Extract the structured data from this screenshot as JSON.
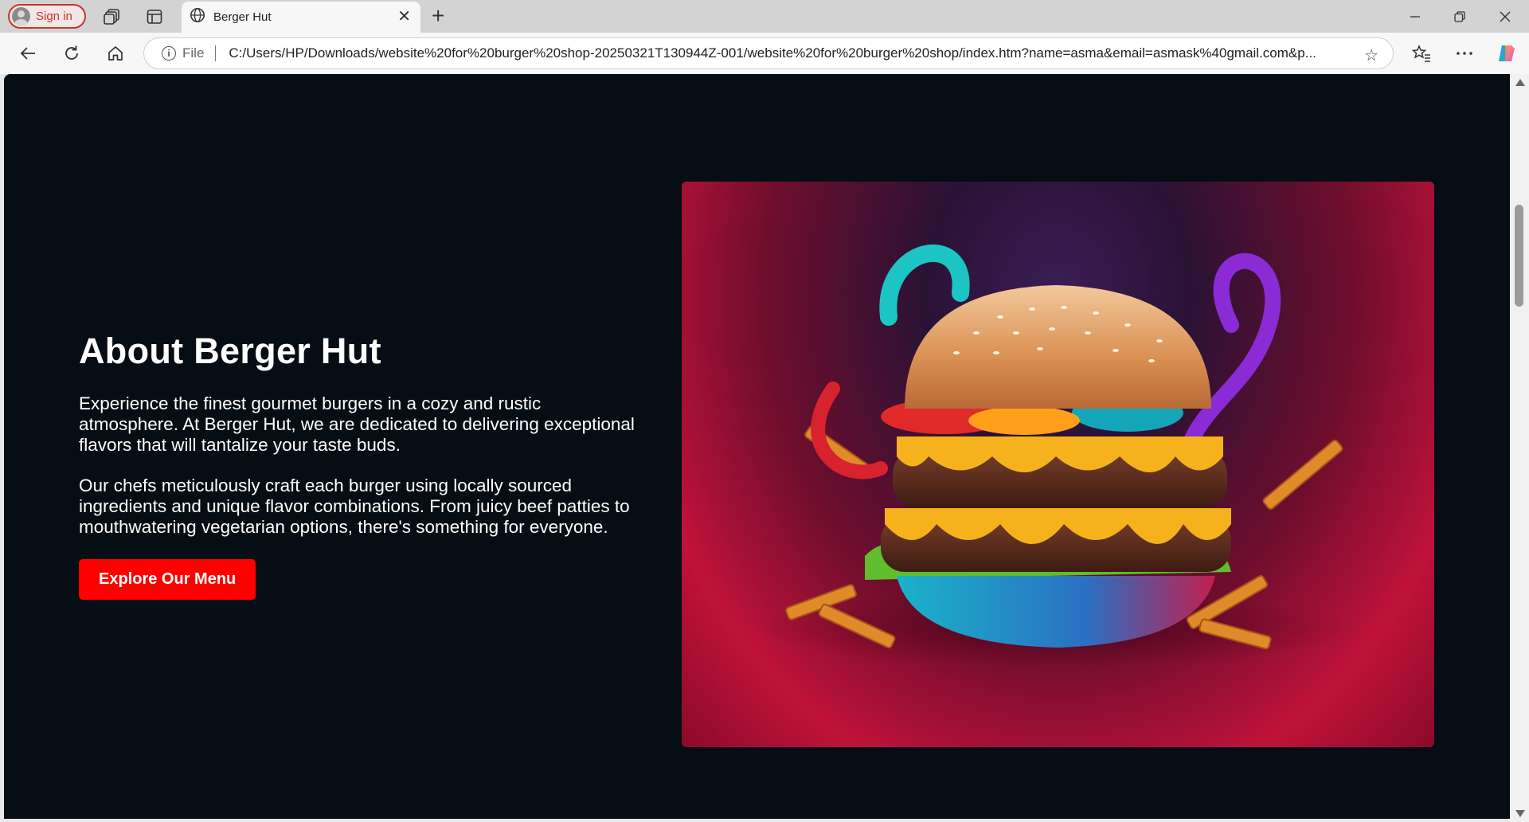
{
  "browser": {
    "signin_label": "Sign in",
    "tab_title": "Berger Hut",
    "omnibox": {
      "scheme_label": "File",
      "url": "C:/Users/HP/Downloads/website%20for%20burger%20shop-20250321T130944Z-001/website%20for%20burger%20shop/index.htm?name=asma&email=asmask%40gmail.com&p..."
    },
    "accent_color": "#c0392b"
  },
  "page": {
    "about": {
      "heading": "About Berger Hut",
      "paragraph_1": "Experience the finest gourmet burgers in a cozy and rustic atmosphere. At Berger Hut, we are dedicated to delivering exceptional flavors that will tantalize your taste buds.",
      "paragraph_2": "Our chefs meticulously craft each burger using locally sourced ingredients and unique flavor combinations. From juicy beef patties to mouthwatering vegetarian options, there's something for everyone.",
      "cta_label": "Explore Our Menu"
    },
    "colors": {
      "background": "#070d14",
      "cta": "#ff0000",
      "text": "#ffffff"
    },
    "hero_image": "burger-photo"
  }
}
